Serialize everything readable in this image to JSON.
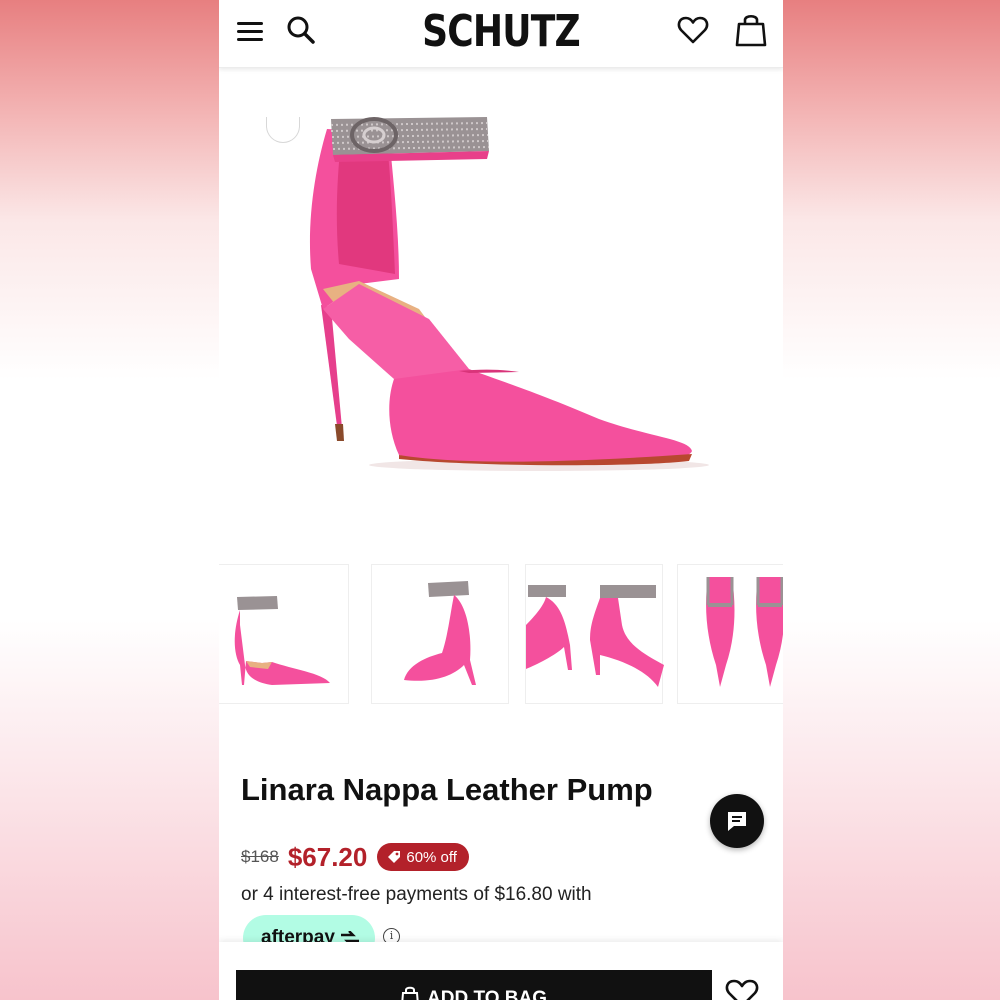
{
  "header": {
    "logo": "SCHUTZ",
    "icons": [
      "menu-icon",
      "search-icon",
      "heart-icon",
      "shopping-bag-icon"
    ]
  },
  "product": {
    "title": "Linara Nappa Leather Pump",
    "original_price": "$168",
    "sale_price": "$67.20",
    "discount_badge": "60% off",
    "installments_text": "or 4 interest-free payments of $16.80 with",
    "afterpay_label": "afterpay",
    "info_label": "i"
  },
  "gallery": {
    "thumbnail_count": 4
  },
  "actions": {
    "add_to_bag_label": "ADD TO BAG"
  },
  "colors": {
    "shoe_pink": "#f4509d",
    "sale_red": "#b3212a",
    "afterpay_mint": "#b2fce4",
    "primary_black": "#111111"
  }
}
